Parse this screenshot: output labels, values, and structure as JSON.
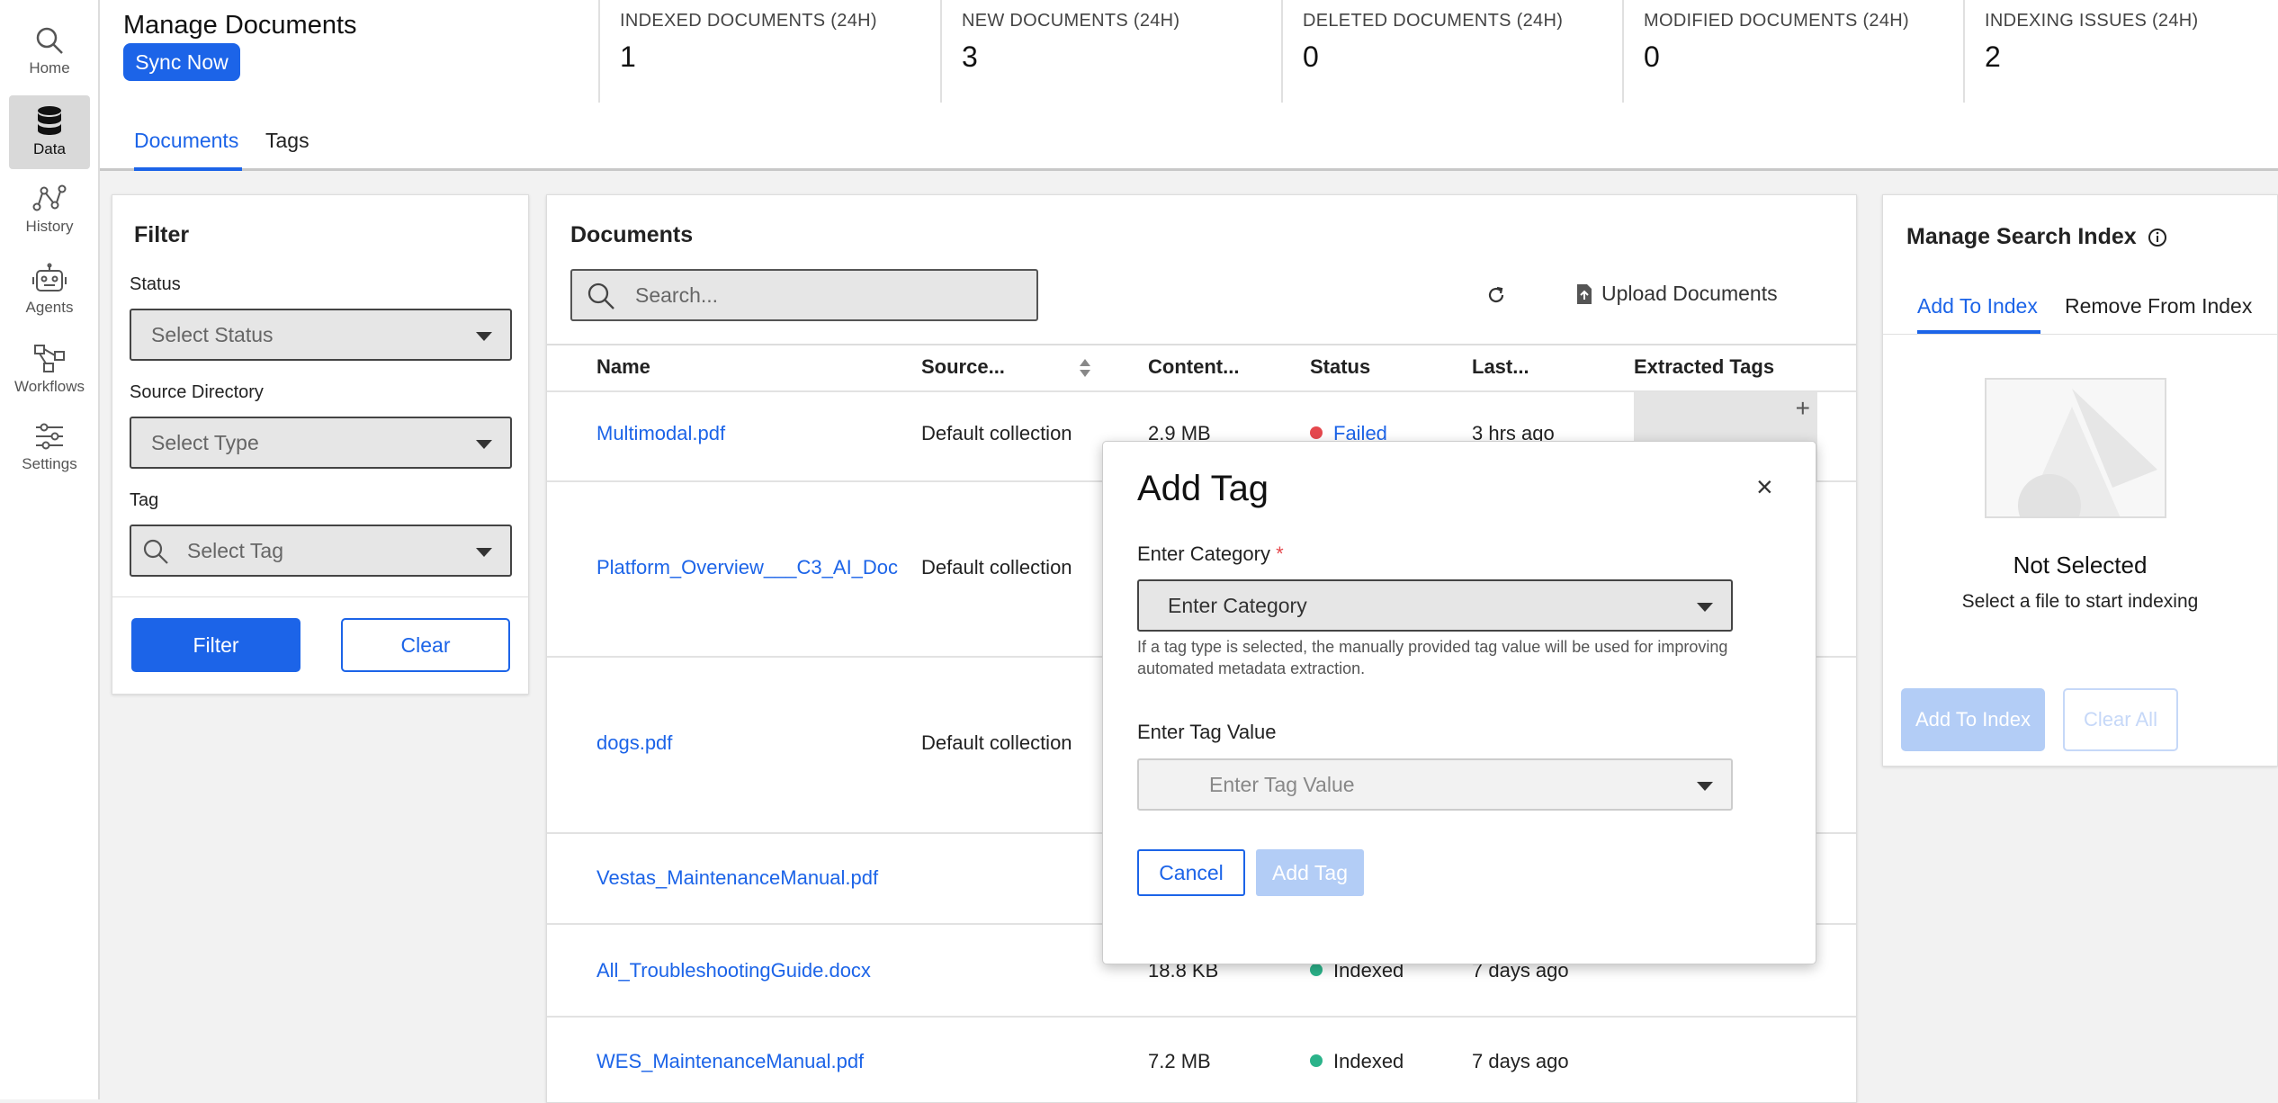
{
  "nav": {
    "items": [
      {
        "label": "Home",
        "icon": "search-icon"
      },
      {
        "label": "Data",
        "icon": "database-icon"
      },
      {
        "label": "History",
        "icon": "history-icon"
      },
      {
        "label": "Agents",
        "icon": "robot-icon"
      },
      {
        "label": "Workflows",
        "icon": "workflow-icon"
      },
      {
        "label": "Settings",
        "icon": "sliders-icon"
      }
    ]
  },
  "header": {
    "title": "Manage Documents",
    "sync_label": "Sync Now",
    "stats": [
      {
        "label": "INDEXED DOCUMENTS (24H)",
        "value": "1"
      },
      {
        "label": "NEW DOCUMENTS (24H)",
        "value": "3"
      },
      {
        "label": "DELETED DOCUMENTS (24H)",
        "value": "0"
      },
      {
        "label": "MODIFIED DOCUMENTS (24H)",
        "value": "0"
      },
      {
        "label": "INDEXING ISSUES (24H)",
        "value": "2"
      }
    ],
    "tabs": [
      {
        "label": "Documents"
      },
      {
        "label": "Tags"
      }
    ]
  },
  "filter": {
    "title": "Filter",
    "status_label": "Status",
    "status_placeholder": "Select Status",
    "source_label": "Source Directory",
    "source_placeholder": "Select Type",
    "tag_label": "Tag",
    "tag_placeholder": "Select Tag",
    "filter_button": "Filter",
    "clear_button": "Clear"
  },
  "documents": {
    "title": "Documents",
    "search_placeholder": "Search...",
    "upload_label": "Upload Documents",
    "columns": [
      "Name",
      "Source...",
      "Content...",
      "Status",
      "Last...",
      "Extracted Tags"
    ],
    "rows": [
      {
        "name": "Multimodal.pdf",
        "source": "Default collection",
        "size": "2.9 MB",
        "status": "Failed",
        "status_color": "#e5484d",
        "last": "3 hrs ago"
      },
      {
        "name": "Platform_Overview___C3_AI_Doc",
        "source": "Default collection",
        "size": "",
        "status": "",
        "status_color": "",
        "last": ""
      },
      {
        "name": "dogs.pdf",
        "source": "Default collection",
        "size": "",
        "status": "",
        "status_color": "",
        "last": ""
      },
      {
        "name": "Vestas_MaintenanceManual.pdf",
        "source": "",
        "size": "",
        "status": "",
        "status_color": "",
        "last": ""
      },
      {
        "name": "All_TroubleshootingGuide.docx",
        "source": "",
        "size": "18.8 KB",
        "status": "Indexed",
        "status_color": "#2bb38a",
        "last": "7 days ago"
      },
      {
        "name": "WES_MaintenanceManual.pdf",
        "source": "",
        "size": "7.2 MB",
        "status": "Indexed",
        "status_color": "#2bb38a",
        "last": "7 days ago"
      }
    ]
  },
  "index_panel": {
    "title": "Manage Search Index",
    "tab_add": "Add To Index",
    "tab_remove": "Remove From Index",
    "empty_title": "Not Selected",
    "empty_text": "Select a file to start indexing",
    "add_button": "Add To Index",
    "clear_button": "Clear All"
  },
  "modal": {
    "title": "Add Tag",
    "close": "×",
    "category_label": "Enter Category",
    "required_mark": "*",
    "category_placeholder": "Enter Category",
    "hint": "If a tag type is selected, the manually provided tag value will be used for improving automated metadata extraction.",
    "value_label": "Enter Tag Value",
    "value_placeholder": "Enter Tag Value",
    "cancel_button": "Cancel",
    "add_button": "Add Tag"
  },
  "colors": {
    "accent": "#1c64e8",
    "failed": "#e5484d",
    "indexed": "#2bb38a"
  }
}
